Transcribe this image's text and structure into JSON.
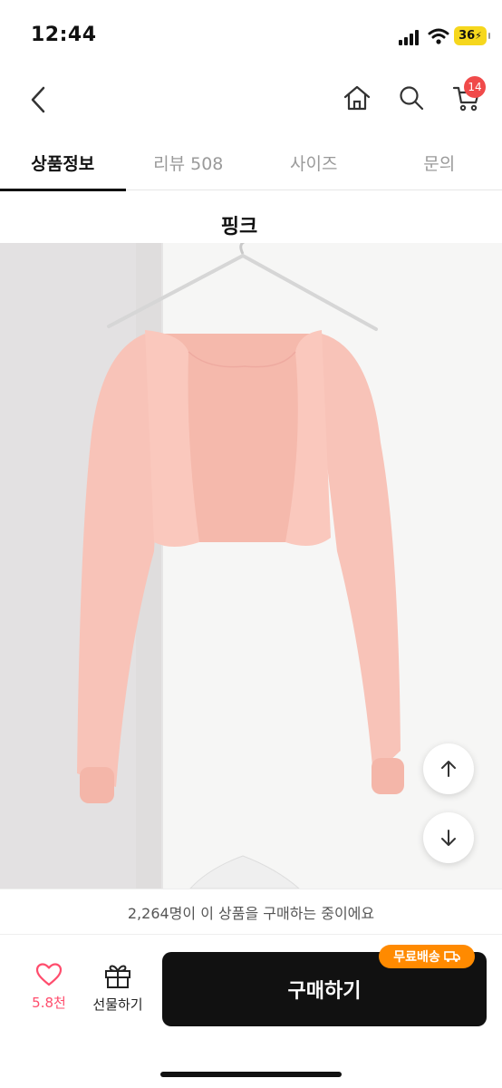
{
  "status_bar": {
    "time": "12:44",
    "battery": "36"
  },
  "header": {
    "cart_badge": "14"
  },
  "tabs": [
    {
      "label": "상품정보",
      "active": true
    },
    {
      "label": "리뷰 508",
      "active": false
    },
    {
      "label": "사이즈",
      "active": false
    },
    {
      "label": "문의",
      "active": false
    }
  ],
  "product": {
    "color_label": "핑크"
  },
  "buyers": {
    "text": "2,264명이 이 상품을 구매하는 중이에요"
  },
  "actions": {
    "like_count": "5.8천",
    "gift_label": "선물하기",
    "buy_label": "구매하기",
    "shipping_badge": "무료배송"
  },
  "colors": {
    "accent_red": "#f04a4a",
    "like_pink": "#ff4d6d",
    "shipping_orange": "#ff8a00",
    "buy_button": "#111111",
    "garment_pink": "#f8c2b8"
  },
  "icons": [
    "back-icon",
    "home-icon",
    "search-icon",
    "cart-icon",
    "heart-icon",
    "gift-icon",
    "truck-icon",
    "arrow-up-icon",
    "arrow-down-icon"
  ]
}
